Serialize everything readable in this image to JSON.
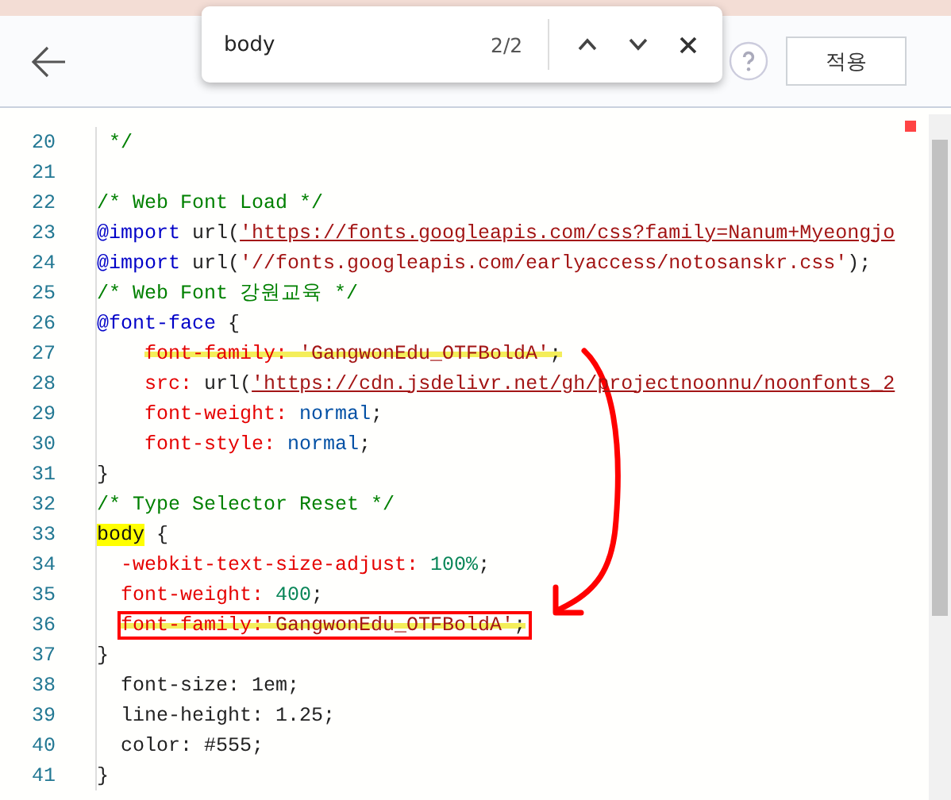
{
  "toolbar": {
    "apply_button": "적용"
  },
  "find": {
    "value": "body",
    "count": "2/2"
  },
  "editor": {
    "lines": [
      {
        "number": "20",
        "marked": false,
        "boxed": false,
        "segs": [
          {
            "text": " */",
            "kind": "comment"
          }
        ]
      },
      {
        "number": "21"
      },
      {
        "number": "22",
        "marked": false,
        "boxed": false,
        "segs": [
          {
            "text": "/* Web Font Load */",
            "kind": "comment"
          }
        ]
      },
      {
        "number": "23",
        "marked": false,
        "boxed": false,
        "segs": [
          {
            "text": "@import",
            "kind": "at"
          },
          {
            "text": " url(",
            "kind": "plain"
          },
          {
            "text": "'https://fonts.googleapis.com/css?family=Nanum+Myeongjo",
            "kind": "error"
          }
        ]
      },
      {
        "number": "24",
        "marked": false,
        "boxed": false,
        "segs": [
          {
            "text": "@import",
            "kind": "at"
          },
          {
            "text": " url(",
            "kind": "plain"
          },
          {
            "text": "'//fonts.googleapis.com/earlyaccess/notosanskr.css'",
            "kind": "string"
          },
          {
            "text": ");",
            "kind": "plain"
          }
        ]
      },
      {
        "number": "25",
        "marked": false,
        "boxed": false,
        "segs": [
          {
            "text": "/* Web Font 강원교육 */",
            "kind": "comment"
          }
        ]
      },
      {
        "number": "26",
        "marked": false,
        "boxed": false,
        "segs": [
          {
            "text": "@font-face",
            "kind": "at"
          },
          {
            "text": " {",
            "kind": "plain"
          }
        ]
      },
      {
        "number": "27",
        "marked": true,
        "boxed": false,
        "segs": [
          {
            "text": "    font-family:",
            "kind": "prop"
          },
          {
            "text": " 'GangwonEdu_OTFBoldA'",
            "kind": "string"
          },
          {
            "text": ";",
            "kind": "plain"
          }
        ]
      },
      {
        "number": "28",
        "marked": false,
        "boxed": false,
        "segs": [
          {
            "text": "    src:",
            "kind": "prop"
          },
          {
            "text": " url(",
            "kind": "plain"
          },
          {
            "text": "'https://cdn.jsdelivr.net/gh/projectnoonnu/noonfonts_2",
            "kind": "error"
          }
        ]
      },
      {
        "number": "29",
        "marked": false,
        "boxed": false,
        "segs": [
          {
            "text": "    font-weight:",
            "kind": "prop"
          },
          {
            "text": " normal",
            "kind": "value"
          },
          {
            "text": ";",
            "kind": "plain"
          }
        ]
      },
      {
        "number": "30",
        "marked": false,
        "boxed": false,
        "segs": [
          {
            "text": "    font-style:",
            "kind": "prop"
          },
          {
            "text": " normal",
            "kind": "value"
          },
          {
            "text": ";",
            "kind": "plain"
          }
        ]
      },
      {
        "number": "31",
        "marked": false,
        "boxed": false,
        "segs": [
          {
            "text": "}",
            "kind": "plain"
          }
        ]
      },
      {
        "number": "32",
        "marked": false,
        "boxed": false,
        "segs": [
          {
            "text": "/* Type Selector Reset */",
            "kind": "comment"
          }
        ]
      },
      {
        "number": "33",
        "marked": false,
        "boxed": false,
        "segs": [
          {
            "text": "body",
            "kind": "match"
          },
          {
            "text": " {",
            "kind": "plain"
          }
        ]
      },
      {
        "number": "34",
        "marked": false,
        "boxed": false,
        "segs": [
          {
            "text": "  -webkit-text-size-adjust:",
            "kind": "prop"
          },
          {
            "text": " 100%",
            "kind": "number"
          },
          {
            "text": ";",
            "kind": "plain"
          }
        ]
      },
      {
        "number": "35",
        "marked": false,
        "boxed": false,
        "segs": [
          {
            "text": "  font-weight:",
            "kind": "prop"
          },
          {
            "text": " 400",
            "kind": "number"
          },
          {
            "text": ";",
            "kind": "plain"
          }
        ]
      },
      {
        "number": "36",
        "marked": true,
        "boxed": true,
        "segs": [
          {
            "text": "  font-family:",
            "kind": "prop"
          },
          {
            "text": "'GangwonEdu_OTFBoldA'",
            "kind": "string"
          },
          {
            "text": ";",
            "kind": "plain"
          }
        ]
      },
      {
        "number": "37",
        "marked": false,
        "boxed": false,
        "segs": [
          {
            "text": "}",
            "kind": "plain"
          }
        ]
      },
      {
        "number": "38",
        "marked": false,
        "boxed": false,
        "segs": [
          {
            "text": "  font-size: 1em;",
            "kind": "plain"
          }
        ]
      },
      {
        "number": "39",
        "marked": false,
        "boxed": false,
        "segs": [
          {
            "text": "  line-height: 1.25;",
            "kind": "plain"
          }
        ]
      },
      {
        "number": "40",
        "marked": false,
        "boxed": false,
        "segs": [
          {
            "text": "  color: #555;",
            "kind": "plain"
          }
        ]
      },
      {
        "number": "41",
        "marked": false,
        "boxed": false,
        "segs": [
          {
            "text": "}",
            "kind": "plain"
          }
        ]
      }
    ]
  }
}
